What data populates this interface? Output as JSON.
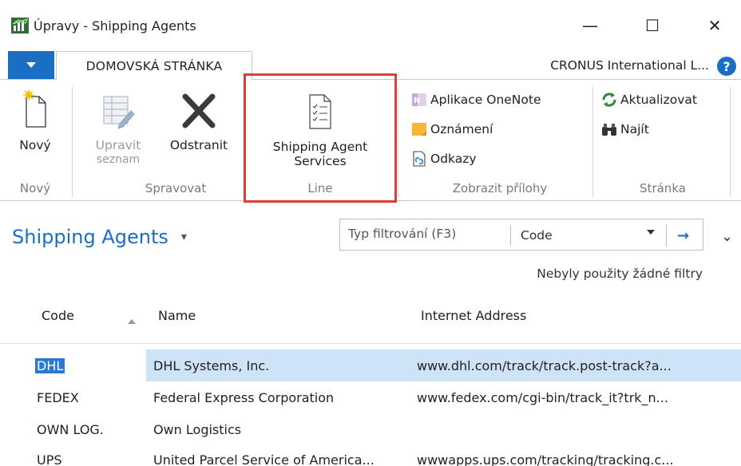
{
  "window": {
    "title": "Úpravy - Shipping Agents",
    "minimize": "—",
    "maximize": "☐",
    "close": "✕"
  },
  "ribbon_tabs": {
    "home": "DOMOVSKÁ STRÁNKA",
    "company": "CRONUS International L...",
    "help": "?"
  },
  "ribbon": {
    "groups": {
      "new": "Nový",
      "manage": "Spravovat",
      "line": "Line",
      "attachments": "Zobrazit přílohy",
      "page": "Stránka"
    },
    "buttons": {
      "new": "Nový",
      "edit_list_1": "Upravit",
      "edit_list_2": "seznam",
      "delete": "Odstranit",
      "shipping_agent_services_1": "Shipping Agent",
      "shipping_agent_services_2": "Services",
      "onenote": "Aplikace OneNote",
      "notes": "Oznámení",
      "links": "Odkazy",
      "refresh": "Aktualizovat",
      "find": "Najít"
    }
  },
  "page": {
    "title": "Shipping Agents",
    "filter_placeholder": "Typ filtrování (F3)",
    "filter_field": "Code",
    "no_filters": "Nebyly použity žádné filtry"
  },
  "table": {
    "columns": [
      "Code",
      "Name",
      "Internet Address"
    ],
    "rows": [
      {
        "code": "DHL",
        "name": "DHL Systems, Inc.",
        "address": "www.dhl.com/track/track.post-track?a..."
      },
      {
        "code": "FEDEX",
        "name": "Federal Express Corporation",
        "address": "www.fedex.com/cgi-bin/track_it?trk_n..."
      },
      {
        "code": "OWN LOG.",
        "name": "Own Logistics",
        "address": ""
      },
      {
        "code": "UPS",
        "name": "United Parcel Service of America...",
        "address": "wwwapps.ups.com/tracking/tracking.c..."
      }
    ]
  },
  "colors": {
    "accent": "#1a6fc4",
    "highlight_box": "#d9403a",
    "selected_row": "#cfe3f6"
  }
}
